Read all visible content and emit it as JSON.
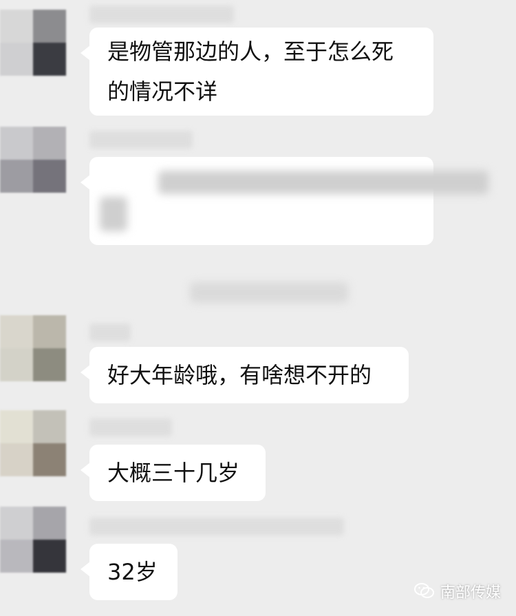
{
  "messages": [
    {
      "text": "是物管那边的人，至于怎么死的情况不详",
      "line1": "是物管那边的人，至于怎么死",
      "line2": "的情况不详"
    },
    {
      "text": "[blurred]"
    },
    {
      "text": "好大年龄哦，有啥想不开的"
    },
    {
      "text": "大概三十几岁"
    },
    {
      "text": "32岁"
    }
  ],
  "watermark": {
    "label": "南部传媒",
    "icon": "wechat-logo-icon"
  },
  "colors": {
    "background": "#ededed",
    "bubble": "#ffffff",
    "text": "#111111"
  }
}
